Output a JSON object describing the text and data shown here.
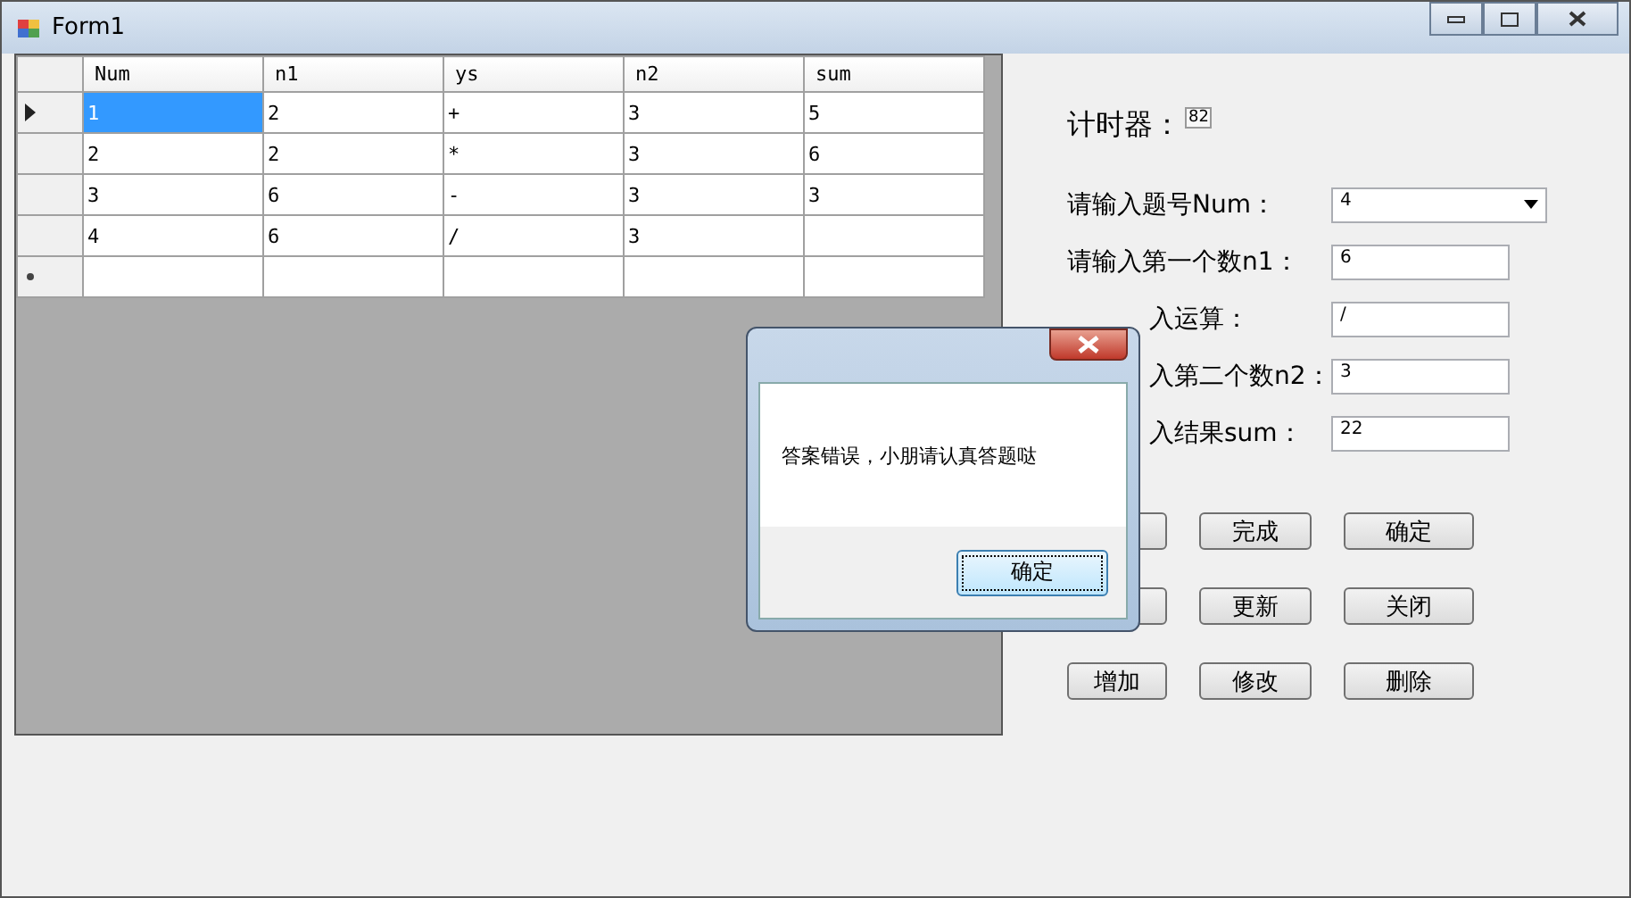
{
  "window": {
    "title": "Form1"
  },
  "table": {
    "columns": [
      "Num",
      "n1",
      "ys",
      "n2",
      "sum"
    ],
    "rows": [
      {
        "current": true,
        "cells": [
          {
            "text": "1",
            "selected": true
          },
          {
            "text": "2",
            "selected": false
          },
          {
            "text": "+",
            "selected": false
          },
          {
            "text": "3",
            "selected": false
          },
          {
            "text": "5",
            "selected": false
          }
        ]
      },
      {
        "current": false,
        "cells": [
          {
            "text": "2",
            "selected": false
          },
          {
            "text": "2",
            "selected": false
          },
          {
            "text": "*",
            "selected": false
          },
          {
            "text": "3",
            "selected": false
          },
          {
            "text": "6",
            "selected": false
          }
        ]
      },
      {
        "current": false,
        "cells": [
          {
            "text": "3",
            "selected": false
          },
          {
            "text": "6",
            "selected": false
          },
          {
            "text": "-",
            "selected": false
          },
          {
            "text": "3",
            "selected": false
          },
          {
            "text": "3",
            "selected": false
          }
        ]
      },
      {
        "current": false,
        "cells": [
          {
            "text": "4",
            "selected": false
          },
          {
            "text": "6",
            "selected": false
          },
          {
            "text": "/",
            "selected": false
          },
          {
            "text": "3",
            "selected": false
          },
          {
            "text": "",
            "selected": false
          }
        ]
      }
    ],
    "new_row": true
  },
  "timer": {
    "label": "计时器：",
    "value": "82"
  },
  "fields": [
    {
      "kind": "combo",
      "label": "请输入题号Num：",
      "value": "4",
      "covered": false
    },
    {
      "kind": "text",
      "label": "请输入第一个数n1：",
      "value": "6",
      "covered": false
    },
    {
      "kind": "text",
      "label": "入运算：",
      "value": "/",
      "covered": true
    },
    {
      "kind": "text",
      "label": "入第二个数n2：",
      "value": "3",
      "covered": true
    },
    {
      "kind": "text",
      "label": "入结果sum：",
      "value": "22",
      "covered": true
    }
  ],
  "button_rows": [
    {
      "buttons": [
        {
          "covered": true
        },
        {
          "label": "完成"
        },
        {
          "label": "确定"
        }
      ]
    },
    {
      "buttons": [
        {
          "covered": true
        },
        {
          "label": "更新"
        },
        {
          "label": "关闭"
        }
      ]
    },
    {
      "buttons": [
        {
          "label": "增加"
        },
        {
          "label": "修改"
        },
        {
          "label": "删除"
        }
      ]
    }
  ],
  "dialog": {
    "message": "答案错误，小朋请认真答题哒",
    "button": "确定"
  }
}
